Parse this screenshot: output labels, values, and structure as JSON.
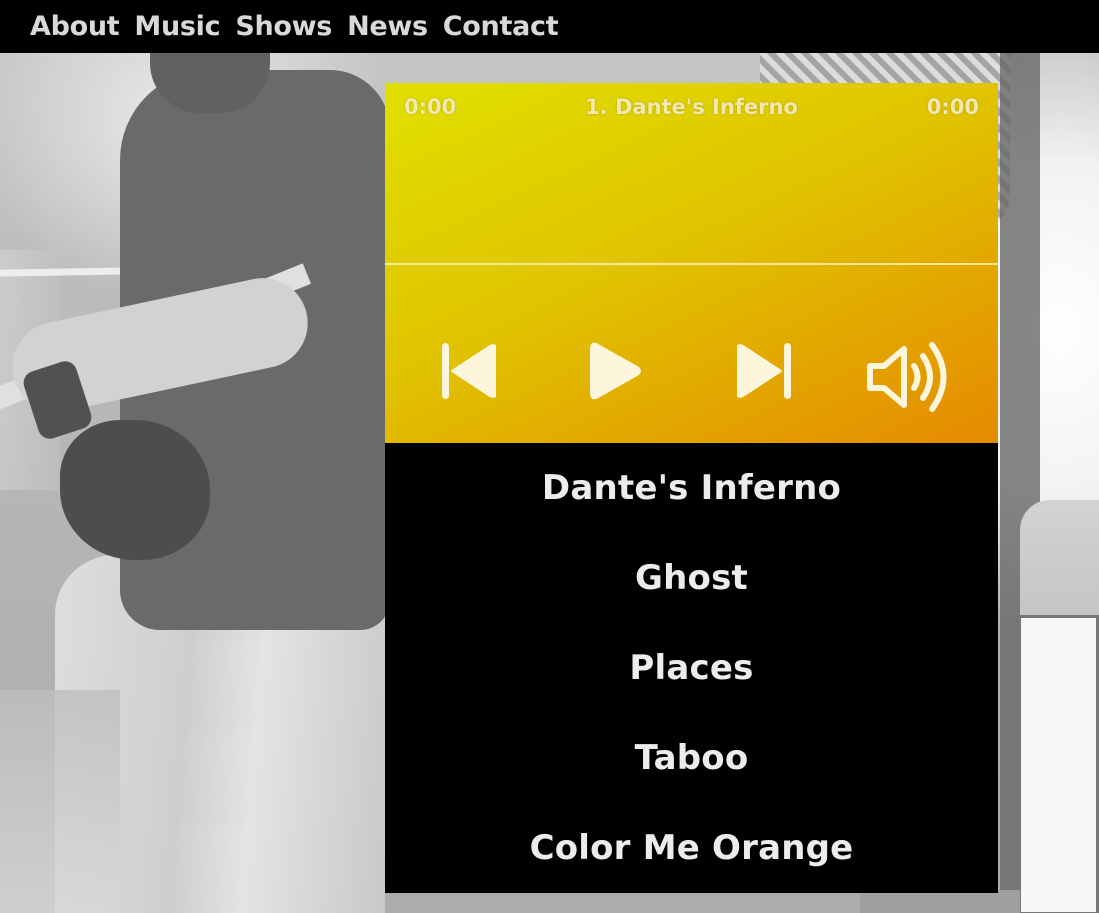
{
  "nav": {
    "links": [
      "About",
      "Music",
      "Shows",
      "News",
      "Contact"
    ]
  },
  "player": {
    "elapsed": "0:00",
    "total": "0:00",
    "now_playing": "1. Dante's Inferno",
    "progress_fraction": 0,
    "icons": [
      "skip-back-icon",
      "play-icon",
      "skip-forward-icon",
      "volume-icon"
    ],
    "colors": {
      "gradient_start": "#e0e000",
      "gradient_end": "#e58a00",
      "icon_color": "#fdf6dc",
      "playlist_background": "#000000",
      "playlist_text": "#ececec"
    }
  },
  "playlist": {
    "tracks": [
      "Dante's Inferno",
      "Ghost",
      "Places",
      "Taboo",
      "Color Me Orange"
    ]
  }
}
